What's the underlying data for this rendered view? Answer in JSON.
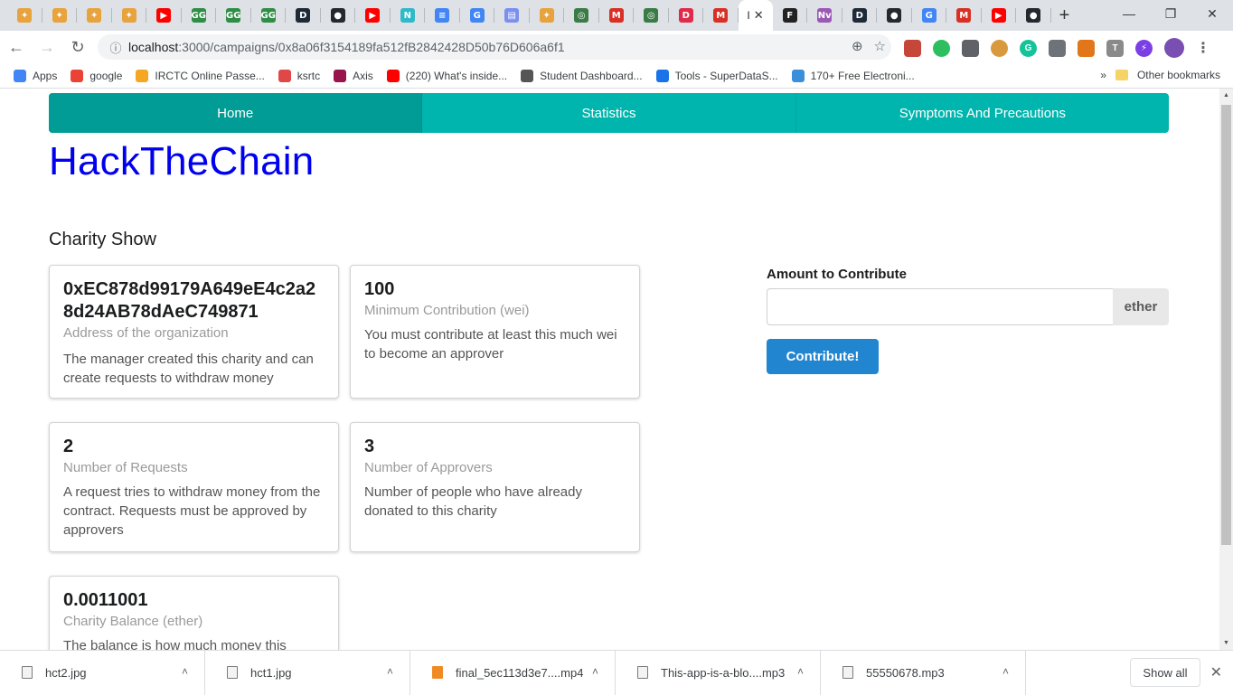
{
  "browser": {
    "tabs": [
      {
        "icon": "github-icon",
        "color": "#e8a33d",
        "glyph": "✦"
      },
      {
        "icon": "github-icon",
        "color": "#e8a33d",
        "glyph": "✦"
      },
      {
        "icon": "github-icon",
        "color": "#e8a33d",
        "glyph": "✦"
      },
      {
        "icon": "github-icon",
        "color": "#e8a33d",
        "glyph": "✦"
      },
      {
        "icon": "youtube-icon",
        "color": "#ff0000",
        "glyph": "▶"
      },
      {
        "icon": "gfg-icon",
        "color": "#2f8d46",
        "glyph": "GG"
      },
      {
        "icon": "gfg-icon",
        "color": "#2f8d46",
        "glyph": "GG"
      },
      {
        "icon": "gfg-icon",
        "color": "#2f8d46",
        "glyph": "GG"
      },
      {
        "icon": "dev-icon",
        "color": "#1e2a38",
        "glyph": "D"
      },
      {
        "icon": "github-icon",
        "color": "#24292e",
        "glyph": "●"
      },
      {
        "icon": "youtube-icon",
        "color": "#ff0000",
        "glyph": "▶"
      },
      {
        "icon": "n-icon",
        "color": "#30b9c9",
        "glyph": "N"
      },
      {
        "icon": "docs-icon",
        "color": "#4285f4",
        "glyph": "≡"
      },
      {
        "icon": "google-icon",
        "color": "#4285f4",
        "glyph": "G"
      },
      {
        "icon": "file-icon",
        "color": "#7a8ff0",
        "glyph": "▤"
      },
      {
        "icon": "github-icon",
        "color": "#e8a33d",
        "glyph": "✦"
      },
      {
        "icon": "globe-icon",
        "color": "#3a7b46",
        "glyph": "◎"
      },
      {
        "icon": "gmail-icon",
        "color": "#d93025",
        "glyph": "M"
      },
      {
        "icon": "globe-icon",
        "color": "#3a7b46",
        "glyph": "◎"
      },
      {
        "icon": "d-icon",
        "color": "#e02b4a",
        "glyph": "D"
      },
      {
        "icon": "gmail-icon",
        "color": "#d93025",
        "glyph": "M"
      }
    ],
    "tabs_after": [
      {
        "icon": "f-icon",
        "color": "#222222",
        "glyph": "F"
      },
      {
        "icon": "nv-icon",
        "color": "#9b59b6",
        "glyph": "Nv"
      },
      {
        "icon": "dev-icon",
        "color": "#1e2a38",
        "glyph": "D"
      },
      {
        "icon": "github-icon",
        "color": "#24292e",
        "glyph": "●"
      },
      {
        "icon": "google-icon",
        "color": "#4285f4",
        "glyph": "G"
      },
      {
        "icon": "gmail-icon",
        "color": "#d93025",
        "glyph": "M"
      },
      {
        "icon": "youtube-icon",
        "color": "#ff0000",
        "glyph": "▶"
      },
      {
        "icon": "github-icon",
        "color": "#24292e",
        "glyph": "●"
      }
    ],
    "active_tab_label": "I",
    "url_host": "localhost",
    "url_rest": ":3000/campaigns/0x8a06f3154189fa512fB2842428D50b76D606a6f1",
    "bookmarks": [
      {
        "label": "Apps",
        "color": "#4285f4"
      },
      {
        "label": "google",
        "color": "#ea4335"
      },
      {
        "label": "IRCTC Online Passe...",
        "color": "#f5a623"
      },
      {
        "label": "ksrtc",
        "color": "#e04848"
      },
      {
        "label": "Axis",
        "color": "#97144d"
      },
      {
        "label": "(220) What's inside...",
        "color": "#ff0000"
      },
      {
        "label": "Student Dashboard...",
        "color": "#555555"
      },
      {
        "label": "Tools - SuperDataS...",
        "color": "#1a73e8"
      },
      {
        "label": "170+ Free Electroni...",
        "color": "#3b8fd9"
      }
    ],
    "bookmarks_more": "»",
    "other_bookmarks": "Other bookmarks"
  },
  "app": {
    "menu": [
      "Home",
      "Statistics",
      "Symptoms And Precautions"
    ],
    "brand": "HackTheChain",
    "section_title": "Charity Show",
    "cards": [
      {
        "header": "0xEC878d99179A649eE4c2a28d24AB78dAeC749871",
        "meta": "Address of the organization",
        "desc": "The manager created this charity and can create requests to withdraw money"
      },
      {
        "header": "100",
        "meta": "Minimum Contribution (wei)",
        "desc": "You must contribute at least this much wei to become an approver"
      },
      {
        "header": "2",
        "meta": "Number of Requests",
        "desc": "A request tries to withdraw money from the contract. Requests must be approved by approvers"
      },
      {
        "header": "3",
        "meta": "Number of Approvers",
        "desc": "Number of people who have already donated to this charity"
      },
      {
        "header": "0.0011001",
        "meta": "Charity Balance (ether)",
        "desc": "The balance is how much money this"
      }
    ],
    "form": {
      "label": "Amount to Contribute",
      "value": "",
      "unit": "ether",
      "button": "Contribute!"
    }
  },
  "downloads": {
    "items": [
      "hct2.jpg",
      "hct1.jpg",
      "final_5ec113d3e7....mp4",
      "This-app-is-a-blo....mp3",
      "55550678.mp3"
    ],
    "show_all": "Show all"
  }
}
